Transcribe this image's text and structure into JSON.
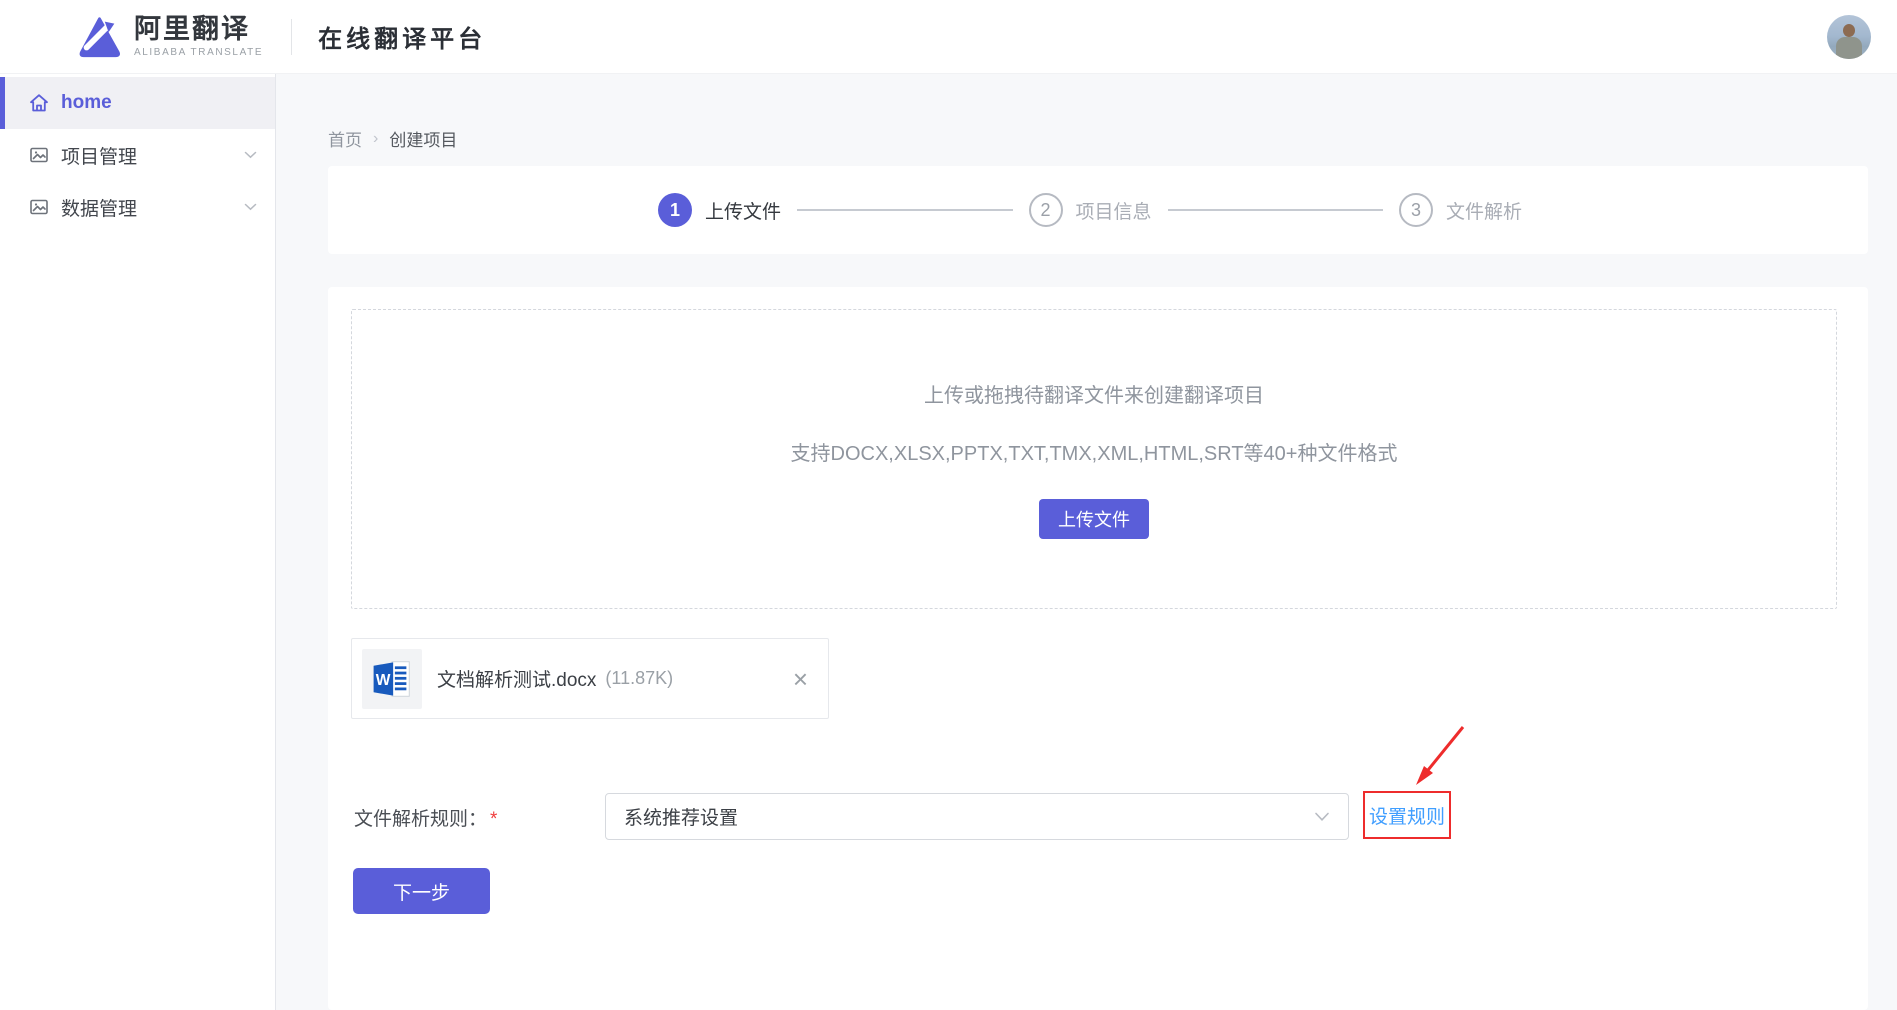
{
  "header": {
    "logo_title": "阿里翻译",
    "logo_subtitle": "ALIBABA TRANSLATE",
    "platform_title": "在线翻译平台"
  },
  "sidebar": {
    "items": [
      {
        "label": "home",
        "active": true
      },
      {
        "label": "项目管理",
        "active": false
      },
      {
        "label": "数据管理",
        "active": false
      }
    ]
  },
  "breadcrumb": {
    "home": "首页",
    "separator": "›",
    "current": "创建项目"
  },
  "stepper": {
    "steps": [
      {
        "number": "1",
        "label": "上传文件",
        "active": true
      },
      {
        "number": "2",
        "label": "项目信息",
        "active": false
      },
      {
        "number": "3",
        "label": "文件解析",
        "active": false
      }
    ]
  },
  "upload": {
    "title": "上传或拖拽待翻译文件来创建翻译项目",
    "formats": "支持DOCX,XLSX,PPTX,TXT,TMX,XML,HTML,SRT等40+种文件格式",
    "button_label": "上传文件"
  },
  "file": {
    "name": "文档解析测试.docx",
    "size": "(11.87K)",
    "icon_letter": "W",
    "close_glyph": "×"
  },
  "form": {
    "label": "文件解析规则：",
    "required_mark": "*",
    "select_value": "系统推荐设置",
    "settings_link": "设置规则"
  },
  "actions": {
    "next_label": "下一步"
  },
  "colors": {
    "accent": "#5a5ed9",
    "link_blue": "#409eff",
    "annotation_red": "#ee2c2c",
    "word_blue": "#185abd"
  }
}
